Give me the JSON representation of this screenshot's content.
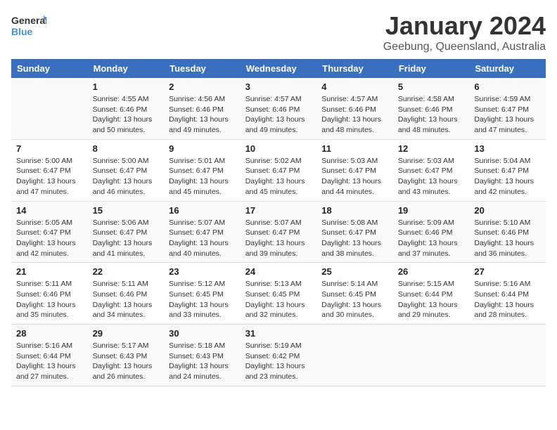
{
  "header": {
    "logo_line1": "General",
    "logo_line2": "Blue",
    "month": "January 2024",
    "location": "Geebung, Queensland, Australia"
  },
  "weekdays": [
    "Sunday",
    "Monday",
    "Tuesday",
    "Wednesday",
    "Thursday",
    "Friday",
    "Saturday"
  ],
  "weeks": [
    [
      {
        "day": "",
        "info": ""
      },
      {
        "day": "1",
        "info": "Sunrise: 4:55 AM\nSunset: 6:46 PM\nDaylight: 13 hours\nand 50 minutes."
      },
      {
        "day": "2",
        "info": "Sunrise: 4:56 AM\nSunset: 6:46 PM\nDaylight: 13 hours\nand 49 minutes."
      },
      {
        "day": "3",
        "info": "Sunrise: 4:57 AM\nSunset: 6:46 PM\nDaylight: 13 hours\nand 49 minutes."
      },
      {
        "day": "4",
        "info": "Sunrise: 4:57 AM\nSunset: 6:46 PM\nDaylight: 13 hours\nand 48 minutes."
      },
      {
        "day": "5",
        "info": "Sunrise: 4:58 AM\nSunset: 6:46 PM\nDaylight: 13 hours\nand 48 minutes."
      },
      {
        "day": "6",
        "info": "Sunrise: 4:59 AM\nSunset: 6:47 PM\nDaylight: 13 hours\nand 47 minutes."
      }
    ],
    [
      {
        "day": "7",
        "info": "Sunrise: 5:00 AM\nSunset: 6:47 PM\nDaylight: 13 hours\nand 47 minutes."
      },
      {
        "day": "8",
        "info": "Sunrise: 5:00 AM\nSunset: 6:47 PM\nDaylight: 13 hours\nand 46 minutes."
      },
      {
        "day": "9",
        "info": "Sunrise: 5:01 AM\nSunset: 6:47 PM\nDaylight: 13 hours\nand 45 minutes."
      },
      {
        "day": "10",
        "info": "Sunrise: 5:02 AM\nSunset: 6:47 PM\nDaylight: 13 hours\nand 45 minutes."
      },
      {
        "day": "11",
        "info": "Sunrise: 5:03 AM\nSunset: 6:47 PM\nDaylight: 13 hours\nand 44 minutes."
      },
      {
        "day": "12",
        "info": "Sunrise: 5:03 AM\nSunset: 6:47 PM\nDaylight: 13 hours\nand 43 minutes."
      },
      {
        "day": "13",
        "info": "Sunrise: 5:04 AM\nSunset: 6:47 PM\nDaylight: 13 hours\nand 42 minutes."
      }
    ],
    [
      {
        "day": "14",
        "info": "Sunrise: 5:05 AM\nSunset: 6:47 PM\nDaylight: 13 hours\nand 42 minutes."
      },
      {
        "day": "15",
        "info": "Sunrise: 5:06 AM\nSunset: 6:47 PM\nDaylight: 13 hours\nand 41 minutes."
      },
      {
        "day": "16",
        "info": "Sunrise: 5:07 AM\nSunset: 6:47 PM\nDaylight: 13 hours\nand 40 minutes."
      },
      {
        "day": "17",
        "info": "Sunrise: 5:07 AM\nSunset: 6:47 PM\nDaylight: 13 hours\nand 39 minutes."
      },
      {
        "day": "18",
        "info": "Sunrise: 5:08 AM\nSunset: 6:47 PM\nDaylight: 13 hours\nand 38 minutes."
      },
      {
        "day": "19",
        "info": "Sunrise: 5:09 AM\nSunset: 6:46 PM\nDaylight: 13 hours\nand 37 minutes."
      },
      {
        "day": "20",
        "info": "Sunrise: 5:10 AM\nSunset: 6:46 PM\nDaylight: 13 hours\nand 36 minutes."
      }
    ],
    [
      {
        "day": "21",
        "info": "Sunrise: 5:11 AM\nSunset: 6:46 PM\nDaylight: 13 hours\nand 35 minutes."
      },
      {
        "day": "22",
        "info": "Sunrise: 5:11 AM\nSunset: 6:46 PM\nDaylight: 13 hours\nand 34 minutes."
      },
      {
        "day": "23",
        "info": "Sunrise: 5:12 AM\nSunset: 6:45 PM\nDaylight: 13 hours\nand 33 minutes."
      },
      {
        "day": "24",
        "info": "Sunrise: 5:13 AM\nSunset: 6:45 PM\nDaylight: 13 hours\nand 32 minutes."
      },
      {
        "day": "25",
        "info": "Sunrise: 5:14 AM\nSunset: 6:45 PM\nDaylight: 13 hours\nand 30 minutes."
      },
      {
        "day": "26",
        "info": "Sunrise: 5:15 AM\nSunset: 6:44 PM\nDaylight: 13 hours\nand 29 minutes."
      },
      {
        "day": "27",
        "info": "Sunrise: 5:16 AM\nSunset: 6:44 PM\nDaylight: 13 hours\nand 28 minutes."
      }
    ],
    [
      {
        "day": "28",
        "info": "Sunrise: 5:16 AM\nSunset: 6:44 PM\nDaylight: 13 hours\nand 27 minutes."
      },
      {
        "day": "29",
        "info": "Sunrise: 5:17 AM\nSunset: 6:43 PM\nDaylight: 13 hours\nand 26 minutes."
      },
      {
        "day": "30",
        "info": "Sunrise: 5:18 AM\nSunset: 6:43 PM\nDaylight: 13 hours\nand 24 minutes."
      },
      {
        "day": "31",
        "info": "Sunrise: 5:19 AM\nSunset: 6:42 PM\nDaylight: 13 hours\nand 23 minutes."
      },
      {
        "day": "",
        "info": ""
      },
      {
        "day": "",
        "info": ""
      },
      {
        "day": "",
        "info": ""
      }
    ]
  ]
}
